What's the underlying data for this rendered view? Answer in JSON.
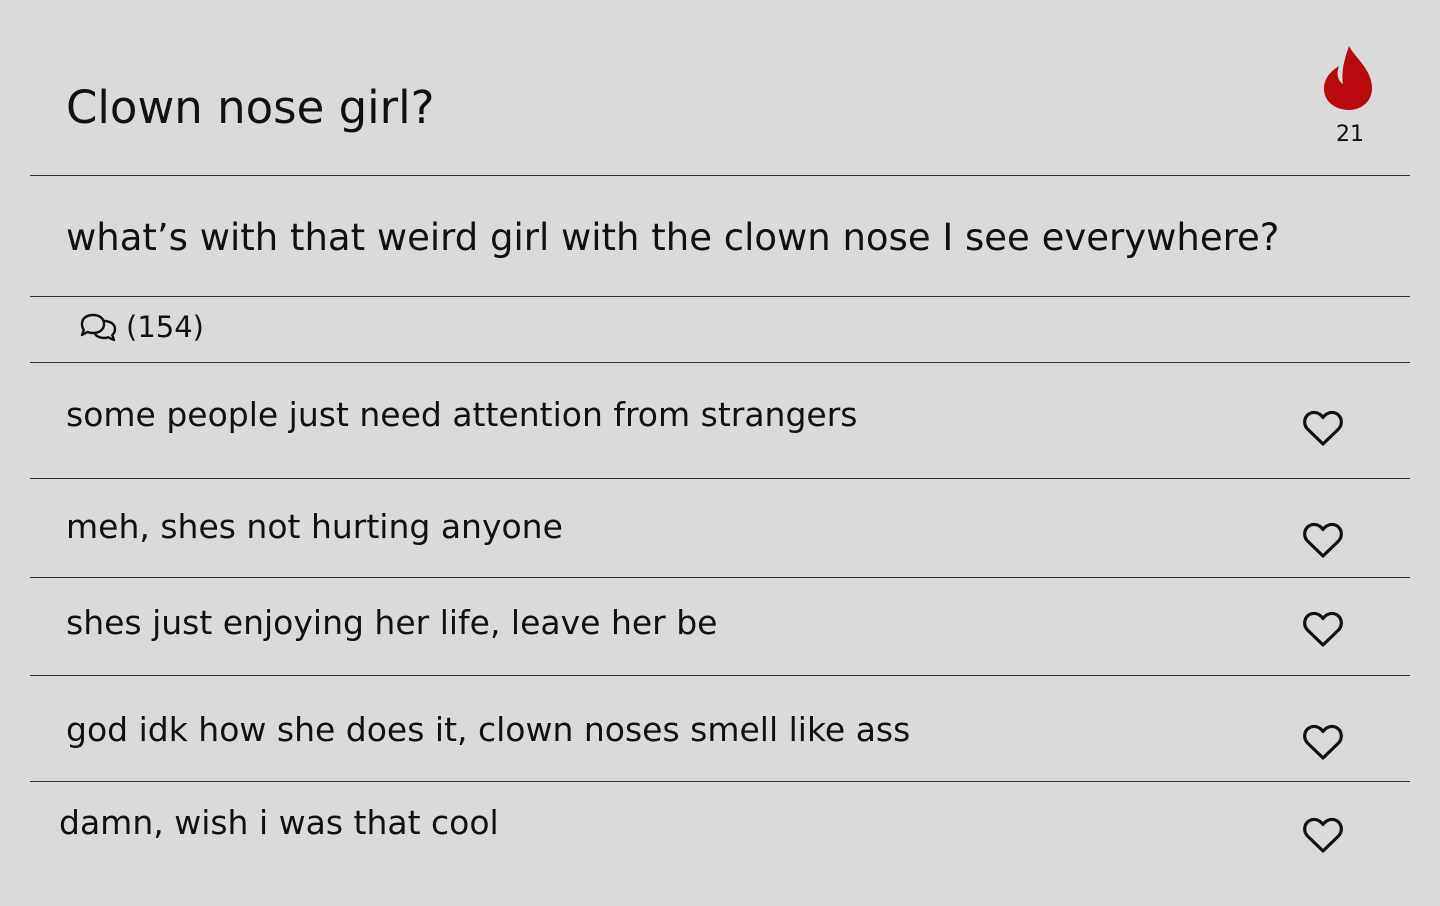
{
  "post": {
    "title": "Clown nose girl?",
    "question": "what’s with that weird girl with the clown nose I see everywhere?",
    "fire_count": "21",
    "comments_count": "(154)",
    "accent_color": "#b80a0a"
  },
  "comments": [
    {
      "text": "some people just need attention from strangers",
      "like_icon": "heart-outline-icon"
    },
    {
      "text": "meh, shes not hurting anyone",
      "like_icon": "heart-outline-icon"
    },
    {
      "text": "shes just enjoying her life, leave her be",
      "like_icon": "heart-outline-icon"
    },
    {
      "text": "god idk how she does it, clown noses smell like ass",
      "like_icon": "heart-outline-icon"
    },
    {
      "text": "damn, wish i was that cool",
      "like_icon": "heart-outline-icon"
    }
  ]
}
